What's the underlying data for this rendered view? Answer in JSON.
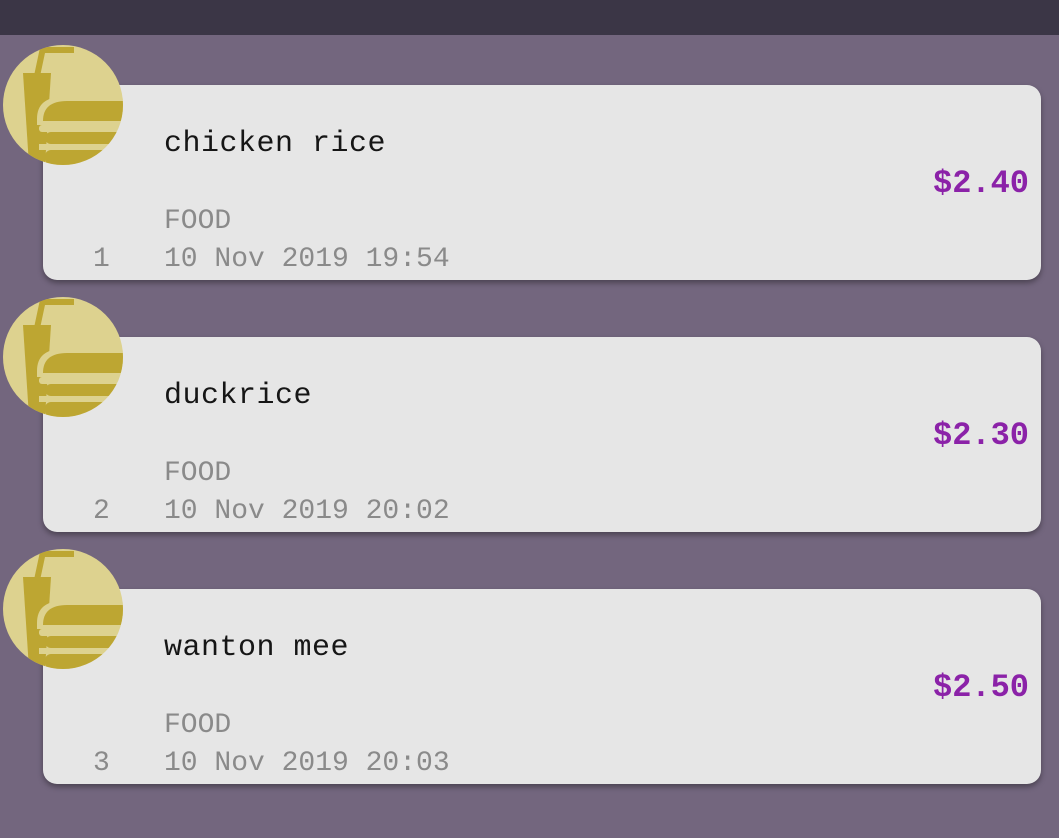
{
  "colors": {
    "background": "#73667e",
    "top_bar": "#3b3646",
    "card": "#e6e6e6",
    "amount": "#8b22a8",
    "category_icon_light": "#ddd28f",
    "category_icon_dark": "#bda632"
  },
  "expenses": [
    {
      "index": "1",
      "description": "chicken rice",
      "category": "FOOD",
      "datetime": "10 Nov 2019 19:54",
      "amount": "$2.40",
      "icon": "food-icon"
    },
    {
      "index": "2",
      "description": "duckrice",
      "category": "FOOD",
      "datetime": "10 Nov 2019 20:02",
      "amount": "$2.30",
      "icon": "food-icon"
    },
    {
      "index": "3",
      "description": "wanton mee",
      "category": "FOOD",
      "datetime": "10 Nov 2019 20:03",
      "amount": "$2.50",
      "icon": "food-icon"
    }
  ]
}
